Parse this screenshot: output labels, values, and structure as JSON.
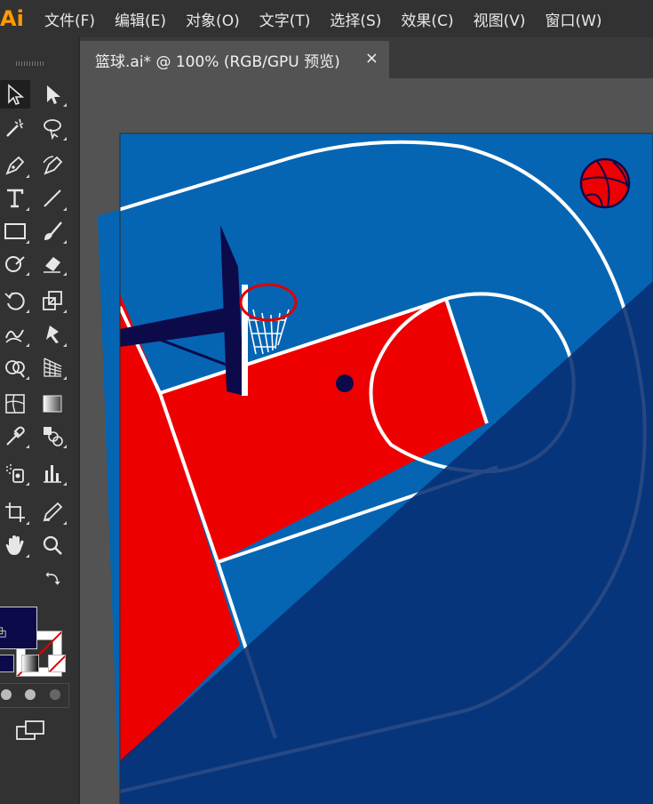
{
  "app": {
    "logo": "Ai"
  },
  "menu": [
    "文件(F)",
    "编辑(E)",
    "对象(O)",
    "文字(T)",
    "选择(S)",
    "效果(C)",
    "视图(V)",
    "窗口(W)"
  ],
  "document": {
    "tab_title": "篮球.ai* @ 100% (RGB/GPU 预览)",
    "close_glyph": "×"
  },
  "tools": [
    "direct-selection-tool",
    "selection-tool",
    "magic-wand-tool",
    "lasso-tool",
    "pen-tool",
    "curvature-tool",
    "type-tool",
    "line-segment-tool",
    "rectangle-tool",
    "paintbrush-tool",
    "shaper-tool",
    "eraser-tool",
    "rotate-tool",
    "scale-tool",
    "warp-tool",
    "puppet-warp-tool",
    "shape-builder-tool",
    "perspective-grid-tool",
    "mesh-tool",
    "gradient-tool",
    "eyedropper-tool",
    "blend-tool",
    "symbol-sprayer-tool",
    "column-graph-tool",
    "artboard-tool",
    "slice-tool",
    "hand-tool",
    "zoom-tool"
  ],
  "colors": {
    "fill": "#0d0a4a",
    "stroke": "none",
    "court_blue": "#0565b3",
    "court_red": "#ef0000",
    "shadow_navy": "#082f73",
    "ball_red": "#ee0000"
  }
}
